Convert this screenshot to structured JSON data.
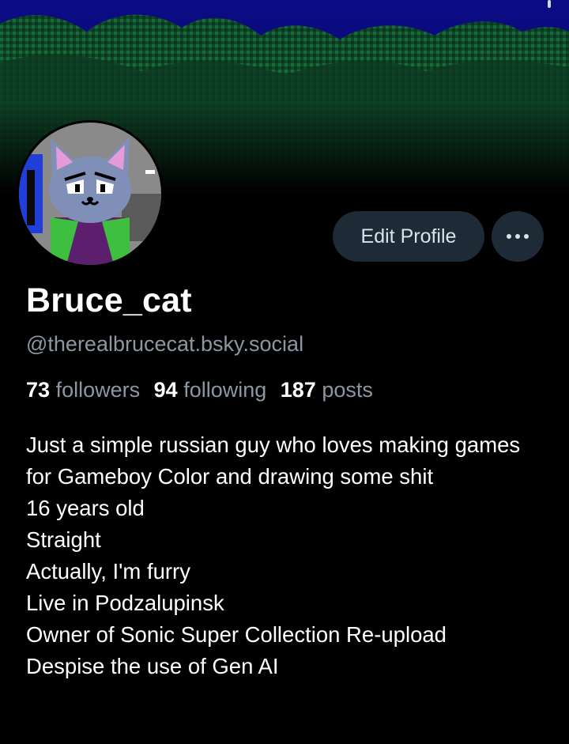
{
  "profile": {
    "display_name": "Bruce_cat",
    "handle": "@therealbrucecat.bsky.social",
    "stats": {
      "followers_count": "73",
      "followers_label": "followers",
      "following_count": "94",
      "following_label": "following",
      "posts_count": "187",
      "posts_label": "posts"
    },
    "bio": {
      "line1": "Just a simple russian guy who loves making games for Gameboy Color and drawing some shit",
      "line2": "16 years old",
      "line3": "Straight",
      "line4": "Actually, I'm furry",
      "line5": "Live in Podzalupinsk",
      "line6": "Owner of Sonic Super Collection Re-upload",
      "line7": "Despise the use of Gen AI"
    }
  },
  "actions": {
    "edit_label": "Edit Profile",
    "more_icon": "ellipsis-icon"
  },
  "colors": {
    "background": "#000000",
    "sky": "#0c0c7a",
    "tree_dark": "#0d3d22",
    "tree_light": "#1f7a40",
    "button_bg": "#1e2a36",
    "muted_text": "#8d97a3"
  }
}
